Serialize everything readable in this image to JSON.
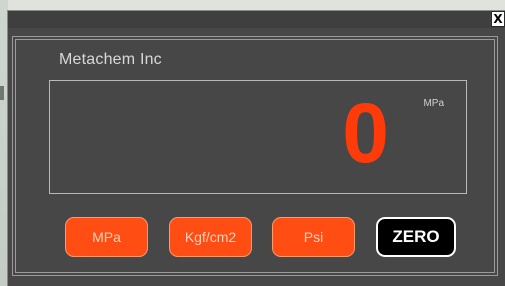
{
  "window": {
    "close_label": "X"
  },
  "panel": {
    "company": "Metachem Inc"
  },
  "display": {
    "value": "0",
    "unit": "MPa",
    "value_color": "#ff3b0a"
  },
  "buttons": {
    "mpa": "MPa",
    "kgf": "Kgf/cm2",
    "psi": "Psi",
    "zero": "ZERO"
  },
  "colors": {
    "panel_bg": "#474747",
    "accent": "#ff4d14",
    "zero_bg": "#000000"
  }
}
